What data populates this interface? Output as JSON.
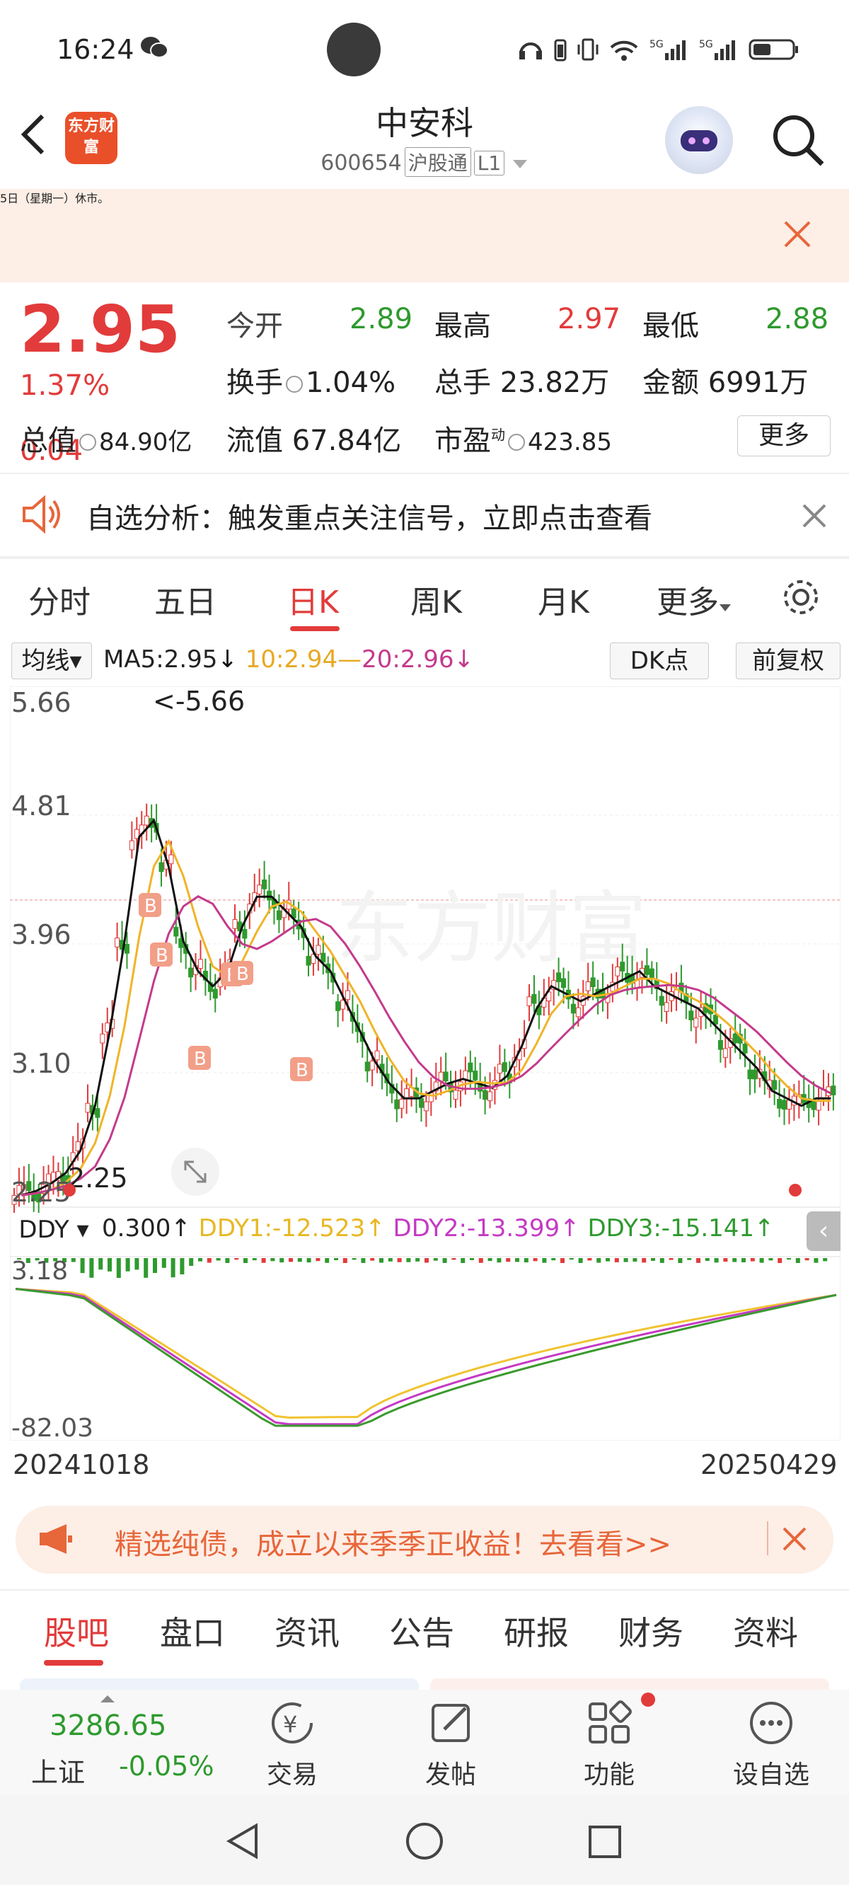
{
  "status": {
    "time": "16:24"
  },
  "header": {
    "logo_text": "东方财富",
    "name": "中安科",
    "code": "600654",
    "tag1": "沪股通",
    "tag2": "L1"
  },
  "notice": {
    "text": "5日（星期一）休市。"
  },
  "quote": {
    "price": "2.95",
    "pct": "1.37%",
    "change": "0.04",
    "open_label": "今开",
    "open": "2.89",
    "high_label": "最高",
    "high": "2.97",
    "low_label": "最低",
    "low": "2.88",
    "turnover_label": "换手",
    "turnover": "1.04%",
    "volume_label": "总手",
    "volume": "23.82万",
    "amount_label": "金额",
    "amount": "6991万",
    "mktcap_label": "总值",
    "mktcap": "84.90亿",
    "float_label": "流值",
    "float": "67.84亿",
    "pe_label": "市盈",
    "pe_sup": "动",
    "pe": "423.85",
    "more": "更多"
  },
  "alert": {
    "text": "自选分析：触发重点关注信号，立即点击查看"
  },
  "chart_tabs": [
    "分时",
    "五日",
    "日K",
    "周K",
    "月K",
    "更多"
  ],
  "ma_bar": {
    "selector": "均线",
    "ma5": "MA5:2.95",
    "ma10": "10:2.94",
    "ma20": "20:2.96",
    "dk": "DK点",
    "adjust": "前复权"
  },
  "chart_labels": {
    "y1": "5.66",
    "y2": "4.81",
    "y3": "3.96",
    "y4": "3.10",
    "y5": "2.25",
    "max_label": "<-5.66",
    "min_label": "2.25",
    "watermark": "东方财富",
    "b_marker": "B"
  },
  "ddy": {
    "selector": "DDY",
    "value": "0.300",
    "ddy1": "DDY1:-12.523",
    "ddy2": "DDY2:-13.399",
    "ddy3": "DDY3:-15.141",
    "ytop": "3.18",
    "ybot": "-82.03"
  },
  "dates": {
    "start": "20241018",
    "end": "20250429"
  },
  "promo": {
    "text": "精选纯债，成立以来季季正收益！去看看>>"
  },
  "bottom_tabs": [
    "股吧",
    "盘口",
    "资讯",
    "公告",
    "研报",
    "财务",
    "资料"
  ],
  "nav": {
    "index_value": "3286.65",
    "index_name": "上证",
    "index_change": "-0.05%",
    "trade": "交易",
    "post": "发帖",
    "func": "功能",
    "watch": "设自选"
  },
  "colors": {
    "up": "#e23b3b",
    "down": "#2e9a2e",
    "ma5": "#111111",
    "ma10": "#f0b429",
    "ma20": "#c43a8c",
    "accent": "#e7663a"
  },
  "chart_data": {
    "type": "candlestick",
    "x_range": [
      "20241018",
      "20250429"
    ],
    "ylim": [
      2.25,
      5.66
    ],
    "ma_close": [
      2.3,
      2.33,
      2.38,
      2.45,
      2.6,
      2.9,
      3.4,
      4.0,
      4.7,
      4.81,
      4.5,
      4.0,
      3.8,
      3.7,
      3.8,
      4.1,
      4.3,
      4.3,
      4.2,
      4.1,
      3.9,
      3.8,
      3.6,
      3.4,
      3.2,
      3.05,
      2.95,
      2.95,
      3.0,
      3.05,
      3.08,
      3.05,
      3.02,
      3.1,
      3.3,
      3.55,
      3.7,
      3.65,
      3.6,
      3.65,
      3.7,
      3.75,
      3.8,
      3.7,
      3.65,
      3.6,
      3.55,
      3.45,
      3.35,
      3.25,
      3.15,
      3.0,
      2.95,
      2.9,
      2.95,
      2.95
    ]
  }
}
